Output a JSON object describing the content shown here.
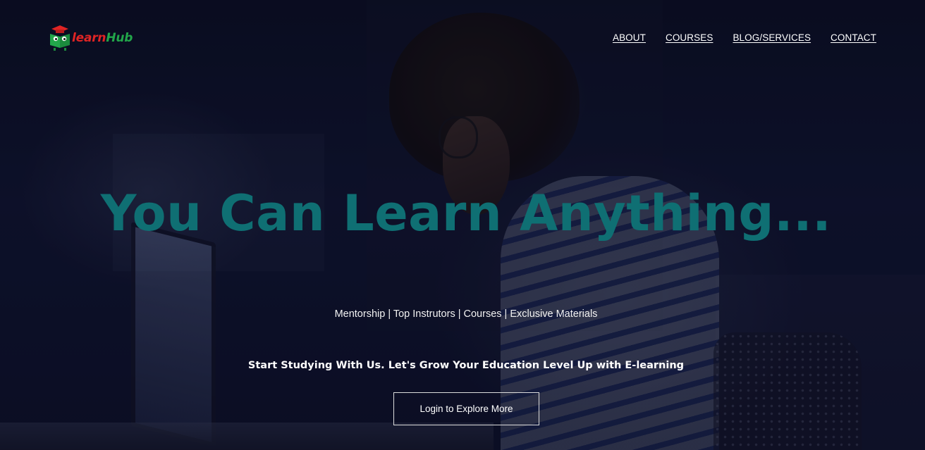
{
  "brand": {
    "logo_text_part1": "learn",
    "logo_text_part2": "Hub",
    "logo_icon": "book-graduation-cap-icon",
    "colors": {
      "learn": "#e02424",
      "hub": "#22a64a"
    }
  },
  "nav": {
    "items": [
      {
        "label": "ABOUT"
      },
      {
        "label": "COURSES"
      },
      {
        "label": "BLOG/SERVICES"
      },
      {
        "label": "CONTACT"
      }
    ]
  },
  "hero": {
    "title": "You Can Learn Anything...",
    "features": "Mentorship | Top Instrutors | Courses | Exclusive Materials",
    "tagline": "Start Studying With Us. Let's Grow Your Education Level Up with E-learning",
    "cta_label": "Login to Explore More",
    "title_color": "#0f6f73"
  }
}
